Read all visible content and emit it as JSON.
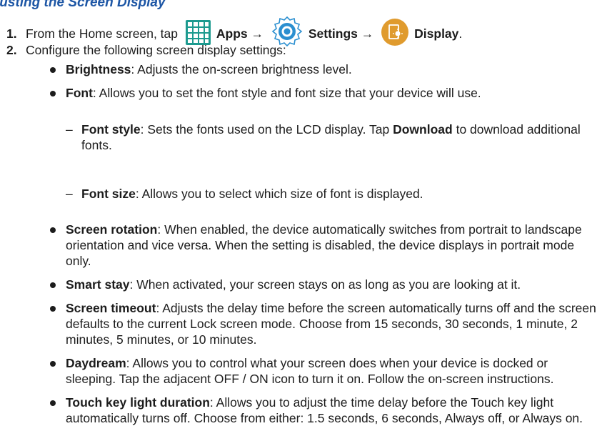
{
  "heading": "justing the Screen Display",
  "step1": {
    "num": "1.",
    "prefix": "From the Home screen, tap ",
    "apps": "Apps",
    "arrow1": " → ",
    "settings": "Settings",
    "arrow2": " → ",
    "display": "Display",
    "end": "."
  },
  "step2": {
    "num": "2.",
    "text": "Configure the following screen display settings:"
  },
  "items": [
    {
      "term": "Brightness",
      "desc": ": Adjusts the on-screen brightness level."
    },
    {
      "term": "Font",
      "desc": ": Allows you to set the font style and font size that your device will use."
    },
    {
      "term": "Screen rotation",
      "desc": ": When enabled, the device automatically switches from portrait to landscape orientation and vice versa. When the setting is disabled, the device displays in portrait mode only."
    },
    {
      "term": "Smart stay",
      "desc": ": When activated, your screen stays on as long as you are looking at it."
    },
    {
      "term": "Screen timeout",
      "desc": ": Adjusts the delay time before the screen automatically turns off and the screen defaults to the current Lock screen mode. Choose from 15 seconds, 30 seconds, 1 minute, 2 minutes, 5 minutes, or 10 minutes."
    },
    {
      "term": "Daydream",
      "desc": ": Allows you to control what your screen does when your device is docked or sleeping. Tap the adjacent OFF / ON icon to turn it on. Follow the on-screen instructions."
    },
    {
      "term": "Touch key light duration",
      "desc": ": Allows you to adjust the time delay before the Touch key light automatically turns off. Choose from either: 1.5 seconds, 6 seconds, Always off, or Always on."
    }
  ],
  "font_subs": [
    {
      "term": "Font style",
      "desc_a": ": Sets the fonts used on the LCD display. Tap ",
      "bold": "Download",
      "desc_b": " to download additional fonts."
    },
    {
      "term": "Font size",
      "desc": ": Allows you to select which size of font is displayed."
    }
  ],
  "icons": {
    "apps": "apps-grid-icon",
    "settings": "settings-gear-icon",
    "display": "display-icon"
  },
  "colors": {
    "heading": "#1d56a5",
    "apps_icon": "#1c9a8f",
    "settings_icon": "#2b8fd0",
    "display_icon": "#e09b2e"
  }
}
